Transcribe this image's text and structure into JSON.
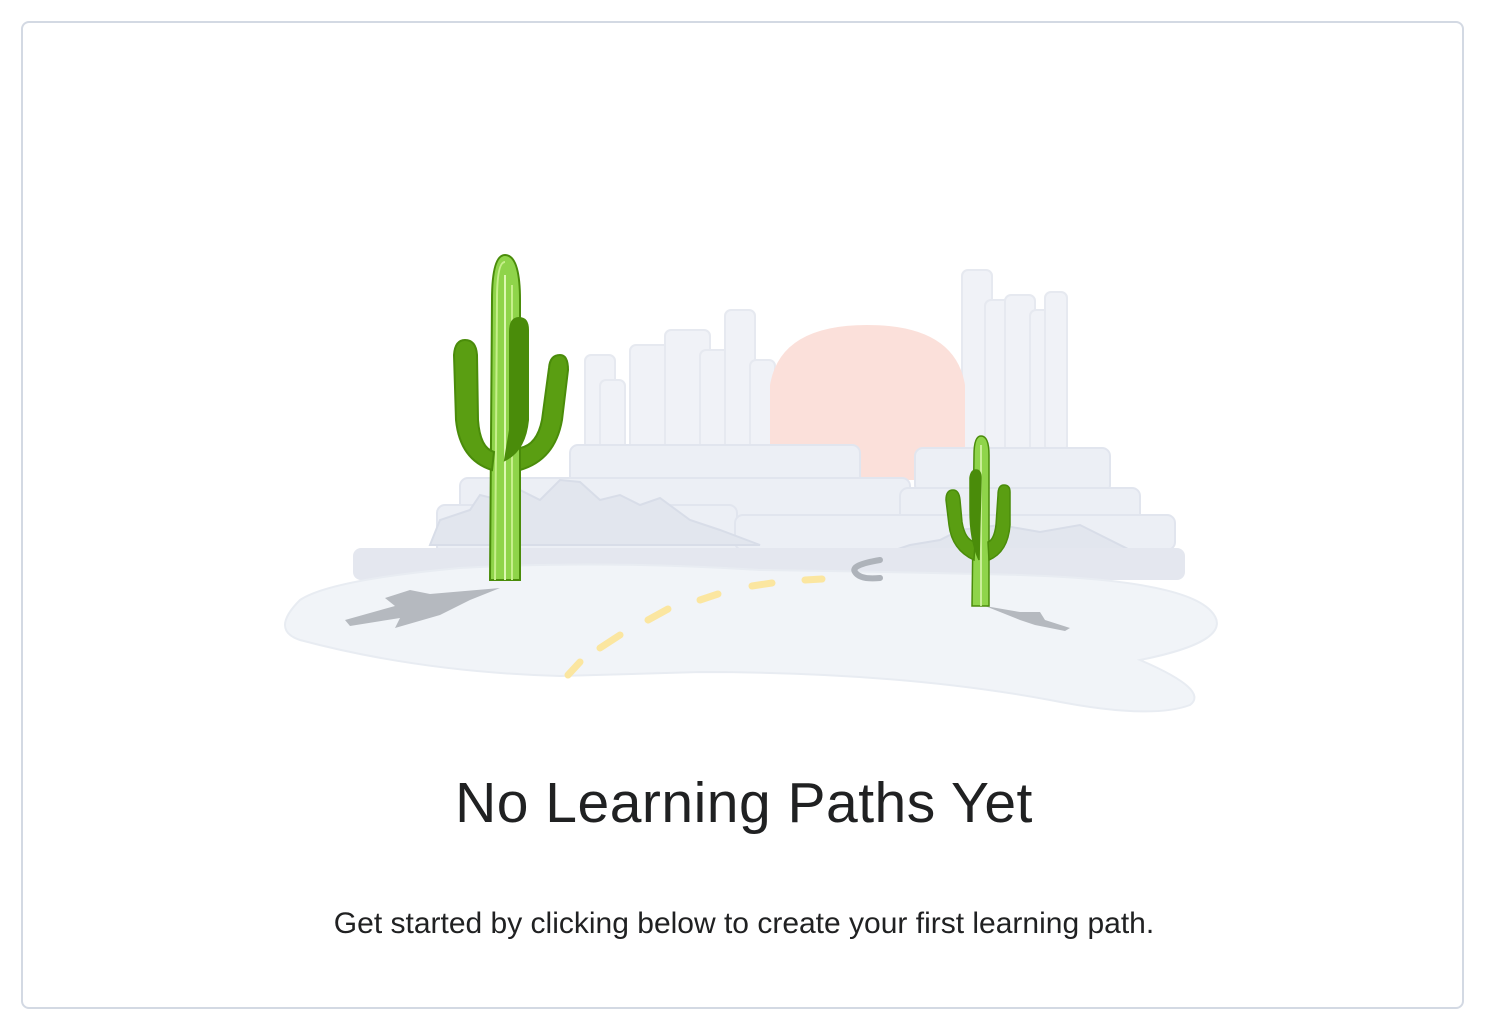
{
  "empty_state": {
    "title": "No Learning Paths Yet",
    "description": "Get started by clicking below to create your first learning path.",
    "illustration": "desert-cactus-illustration"
  },
  "colors": {
    "card_border": "#d3d9e3",
    "text": "#202122",
    "cactus_dark": "#4a8c0a",
    "cactus_light": "#8fd44a",
    "sun": "#fbe0da",
    "mesa": "#e6e9f0",
    "road_dash": "#fbe6a0",
    "ground": "#f1f4f8"
  }
}
